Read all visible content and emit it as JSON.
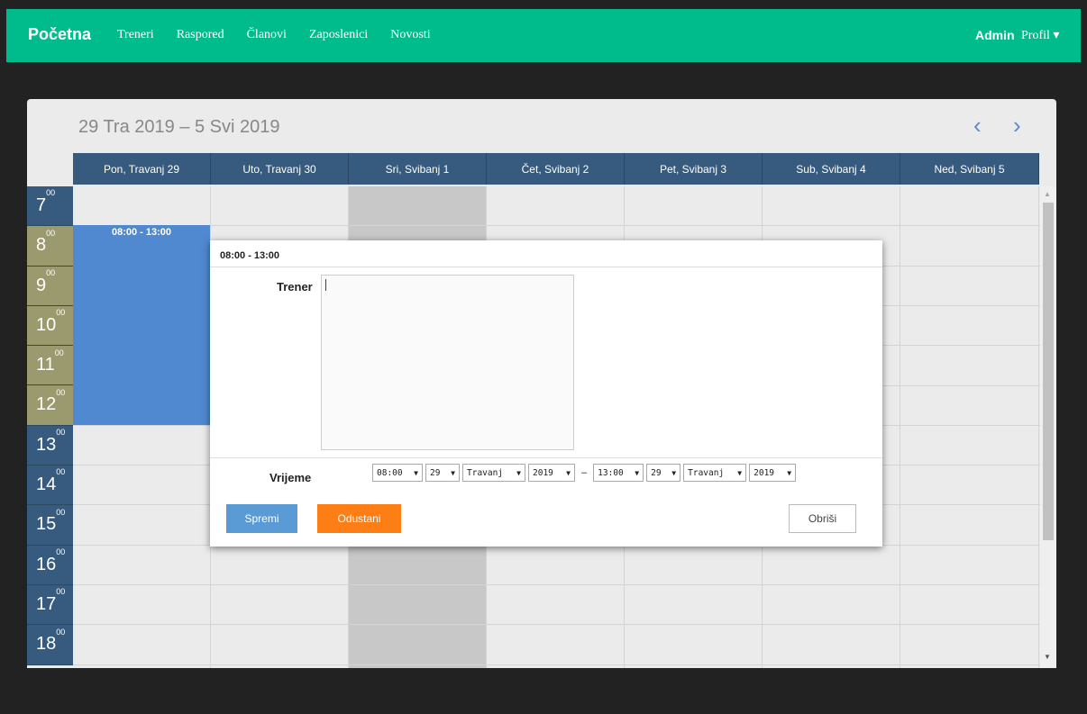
{
  "nav": {
    "brand": "Početna",
    "links": [
      "Treneri",
      "Raspored",
      "Članovi",
      "Zaposlenici",
      "Novosti"
    ],
    "admin": "Admin",
    "profile": "Profil ▾"
  },
  "calendar": {
    "range_title": "29 Tra 2019 – 5 Svi 2019",
    "prev_label": "‹",
    "next_label": "›",
    "days": [
      "Pon, Travanj 29",
      "Uto, Travanj 30",
      "Sri, Svibanj 1",
      "Čet, Svibanj 2",
      "Pet, Svibanj 3",
      "Sub, Svibanj 4",
      "Ned, Svibanj 5"
    ],
    "hours": [
      "7",
      "8",
      "9",
      "10",
      "11",
      "12",
      "13",
      "14",
      "15",
      "16",
      "17",
      "18"
    ],
    "minutes_label": "00",
    "event_time": "08:00 - 13:00",
    "highlight_color": "#c8c8c8",
    "event_color": "#5089d0"
  },
  "modal": {
    "title": "08:00 - 13:00",
    "trener_label": "Trener",
    "trener_value": "",
    "vrijeme_label": "Vrijeme",
    "start": {
      "time": "08:00",
      "day": "29",
      "month": "Travanj",
      "year": "2019"
    },
    "separator": "–",
    "end": {
      "time": "13:00",
      "day": "29",
      "month": "Travanj",
      "year": "2019"
    },
    "save_label": "Spremi",
    "cancel_label": "Odustani",
    "delete_label": "Obriši"
  }
}
